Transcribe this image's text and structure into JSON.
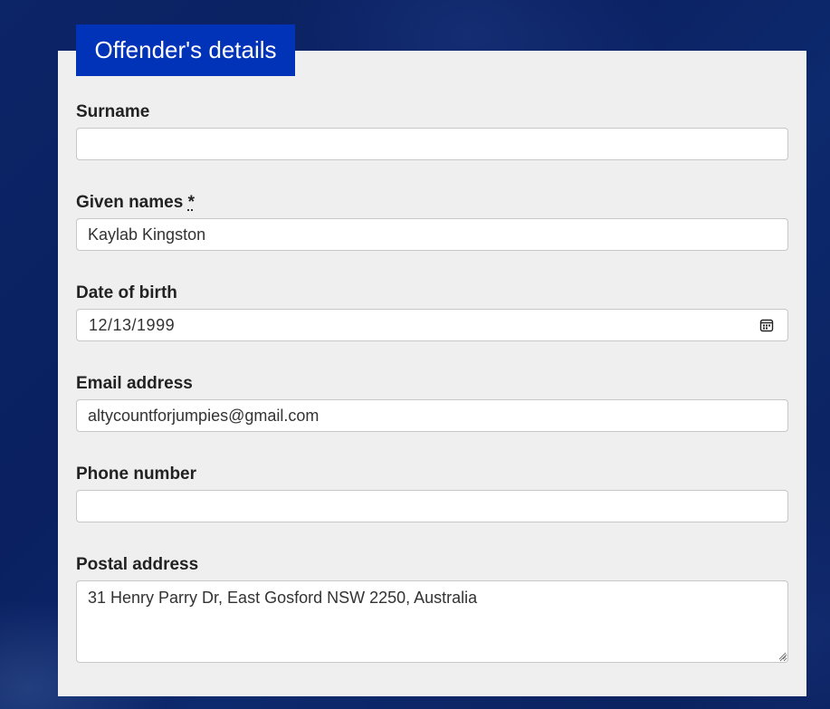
{
  "section": {
    "legend": "Offender's details"
  },
  "fields": {
    "surname": {
      "label": "Surname",
      "value": ""
    },
    "given_names": {
      "label": "Given names",
      "required_marker": "*",
      "value": "Kaylab Kingston"
    },
    "date_of_birth": {
      "label": "Date of birth",
      "value": "12/13/1999",
      "icon": "calendar-icon"
    },
    "email": {
      "label": "Email address",
      "value": "altycountforjumpies@gmail.com"
    },
    "phone": {
      "label": "Phone number",
      "value": ""
    },
    "postal_address": {
      "label": "Postal address",
      "value": "31 Henry Parry Dr, East Gosford NSW 2250, Australia"
    }
  },
  "colors": {
    "legend_bg": "#0033b8",
    "panel_bg": "#efefef",
    "page_bg": "#0a2060"
  }
}
